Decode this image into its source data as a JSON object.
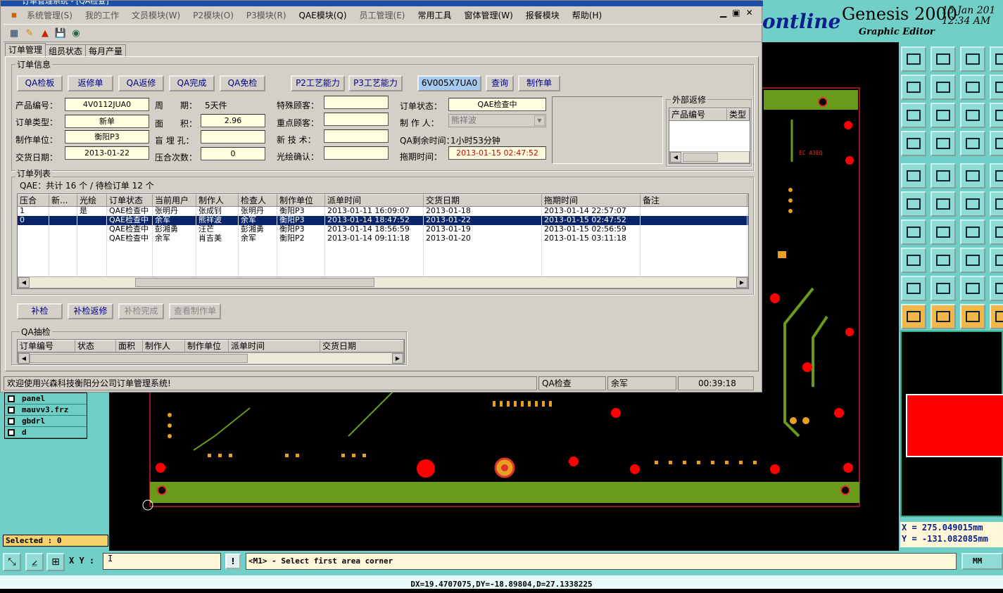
{
  "window": {
    "title": "订单管理系统 - [QA检查]"
  },
  "menu": [
    "系统管理(S)",
    "我的工作",
    "文员模块(W)",
    "P2模块(O)",
    "P3模块(R)",
    "QAE模块(Q)",
    "员工管理(E)",
    "常用工具",
    "窗体管理(W)",
    "报餐模块",
    "帮助(H)"
  ],
  "tabs": [
    "订单管理",
    "组员状态",
    "每月产量"
  ],
  "order_info": {
    "group_label": "订单信息",
    "buttons": [
      "QA检板",
      "返修单",
      "QA返修",
      "QA完成",
      "QA免检"
    ],
    "p_buttons": [
      "P2工艺能力",
      "P3工艺能力"
    ],
    "order_code": "6V005X7UA0",
    "query_btn": "查询",
    "make_btn": "制作单",
    "fields": {
      "product_no_label": "产品编号：",
      "product_no": "4V0112JUA0",
      "order_type_label": "订单类型：",
      "order_type": "新单",
      "maker_unit_label": "制作单位：",
      "maker_unit": "衡阳P3",
      "delivery_label": "交货日期：",
      "delivery": "2013-01-22",
      "period_label": "周　　期：",
      "period": "5天件",
      "area_label": "面　　积：",
      "area": "2.96",
      "blind_label": "盲 埋 孔：",
      "blind": "",
      "press_label": "压合次数：",
      "press": "0",
      "special_label": "特殊顾客：",
      "special": "",
      "key_label": "重点顾客：",
      "key": "",
      "newtech_label": "新 技 术：",
      "newtech": "",
      "light_label": "光绘确认：",
      "light": "",
      "status_label": "订单状态：",
      "status": "QAE检查中",
      "maker_label": "制 作 人：",
      "maker": "熊祥波",
      "qa_left_label": "QA剩余时间：",
      "qa_left": "1小时53分钟",
      "drag_label": "拖期时间：",
      "drag": "2013-01-15 02:47:52"
    },
    "external": {
      "label": "外部返修",
      "cols": [
        "产品编号",
        "类型"
      ]
    }
  },
  "order_list": {
    "label": "订单列表",
    "summary": "QAE：共计 16 个 / 待检订单 12 个",
    "cols": [
      "压合",
      "新...",
      "光绘",
      "订单状态",
      "当前用户",
      "制作人",
      "检查人",
      "制作单位",
      "派单时间",
      "交货日期",
      "拖期时间",
      "备注"
    ],
    "rows": [
      [
        "1",
        "",
        "是",
        "QAE检查中",
        "张明丹",
        "张成钊",
        "张明丹",
        "衡阳P3",
        "2013-01-11 16:09:07",
        "2013-01-18",
        "2013-01-14 22:57:07",
        ""
      ],
      [
        "0",
        "",
        "",
        "QAE检查中",
        "余军",
        "熊祥波",
        "余军",
        "衡阳P3",
        "2013-01-14 18:47:52",
        "2013-01-22",
        "2013-01-15 02:47:52",
        ""
      ],
      [
        "",
        "",
        "",
        "QAE检查中",
        "彭湘勇",
        "汪芒",
        "彭湘勇",
        "衡阳P3",
        "2013-01-14 18:56:59",
        "2013-01-19",
        "2013-01-15 02:56:59",
        ""
      ],
      [
        "",
        "",
        "",
        "QAE检查中",
        "余军",
        "肖吉美",
        "余军",
        "衡阳P2",
        "2013-01-14 09:11:18",
        "2013-01-20",
        "2013-01-15 03:11:18",
        ""
      ]
    ],
    "selected_row": 1
  },
  "bottom_buttons": [
    "补检",
    "补检返修",
    "补检完成",
    "查看制作单"
  ],
  "qa_sample": {
    "label": "QA抽检",
    "cols": [
      "订单编号",
      "状态",
      "面积",
      "制作人",
      "制作单位",
      "派单时间",
      "交货日期"
    ]
  },
  "status_bar": {
    "welcome": "欢迎使用兴森科技衡阳分公司订单管理系统!",
    "mode": "QA检查",
    "user": "余军",
    "time": "00:39:18"
  },
  "genesis": {
    "logo": "ontline",
    "title": "Genesis 2000",
    "subtitle": "Graphic Editor",
    "date": "15 Jan 201\n12:34 AM",
    "layers": [
      "panel",
      "mauvv3.frz",
      "gbdrl",
      "d"
    ],
    "selected": "Selected : 0",
    "xy_label": "X Y :",
    "xy_value": "I",
    "excl": "!",
    "message": "<M1> - Select first area corner",
    "units": "MM",
    "coords": "X = 275.049015mm\nY = -131.082085mm",
    "delta": "DX=19.4707075,DY=-18.89804,D=27.1338225",
    "colors": {
      "teal": "#70cfc6",
      "green": "#6a9a1a",
      "pad": "#e8a020",
      "red": "#ff0000"
    }
  }
}
